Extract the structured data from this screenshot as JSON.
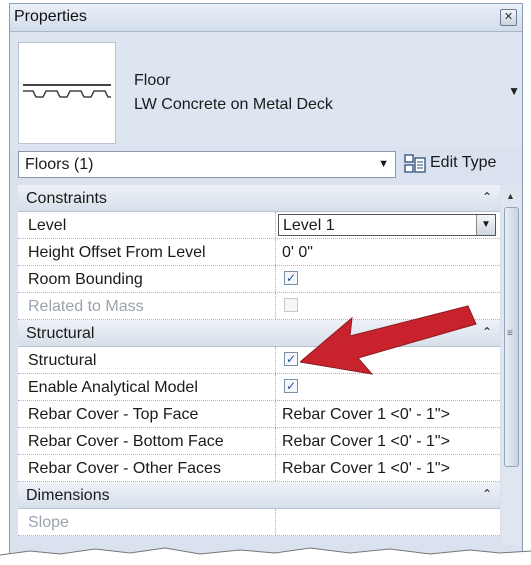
{
  "window": {
    "title": "Properties",
    "close_icon": "close-icon"
  },
  "type_selector": {
    "family": "Floor",
    "type": "LW Concrete on Metal Deck"
  },
  "filter": {
    "value": "Floors (1)"
  },
  "edit_type": {
    "label": "Edit Type"
  },
  "grid": {
    "constraints": {
      "label": "Constraints",
      "level": {
        "name": "Level",
        "value": "Level 1"
      },
      "height_offset": {
        "name": "Height Offset From Level",
        "value": "0'  0\""
      },
      "room_bounding": {
        "name": "Room Bounding",
        "checked": true
      },
      "related_to_mass": {
        "name": "Related to Mass",
        "checked": false
      }
    },
    "structural": {
      "label": "Structural",
      "structural": {
        "name": "Structural",
        "checked": true
      },
      "enable_analytical": {
        "name": "Enable Analytical Model",
        "checked": true
      },
      "rebar_top": {
        "name": "Rebar Cover - Top Face",
        "value": "Rebar Cover 1 <0' - 1\">"
      },
      "rebar_bottom": {
        "name": "Rebar Cover - Bottom Face",
        "value": "Rebar Cover 1 <0' - 1\">"
      },
      "rebar_other": {
        "name": "Rebar Cover - Other Faces",
        "value": "Rebar Cover 1 <0' - 1\">"
      }
    },
    "dimensions": {
      "label": "Dimensions",
      "slope": {
        "name": "Slope"
      }
    }
  },
  "colors": {
    "annotation_arrow": "#c8232c",
    "panel_bg": "#d9e2ee"
  }
}
